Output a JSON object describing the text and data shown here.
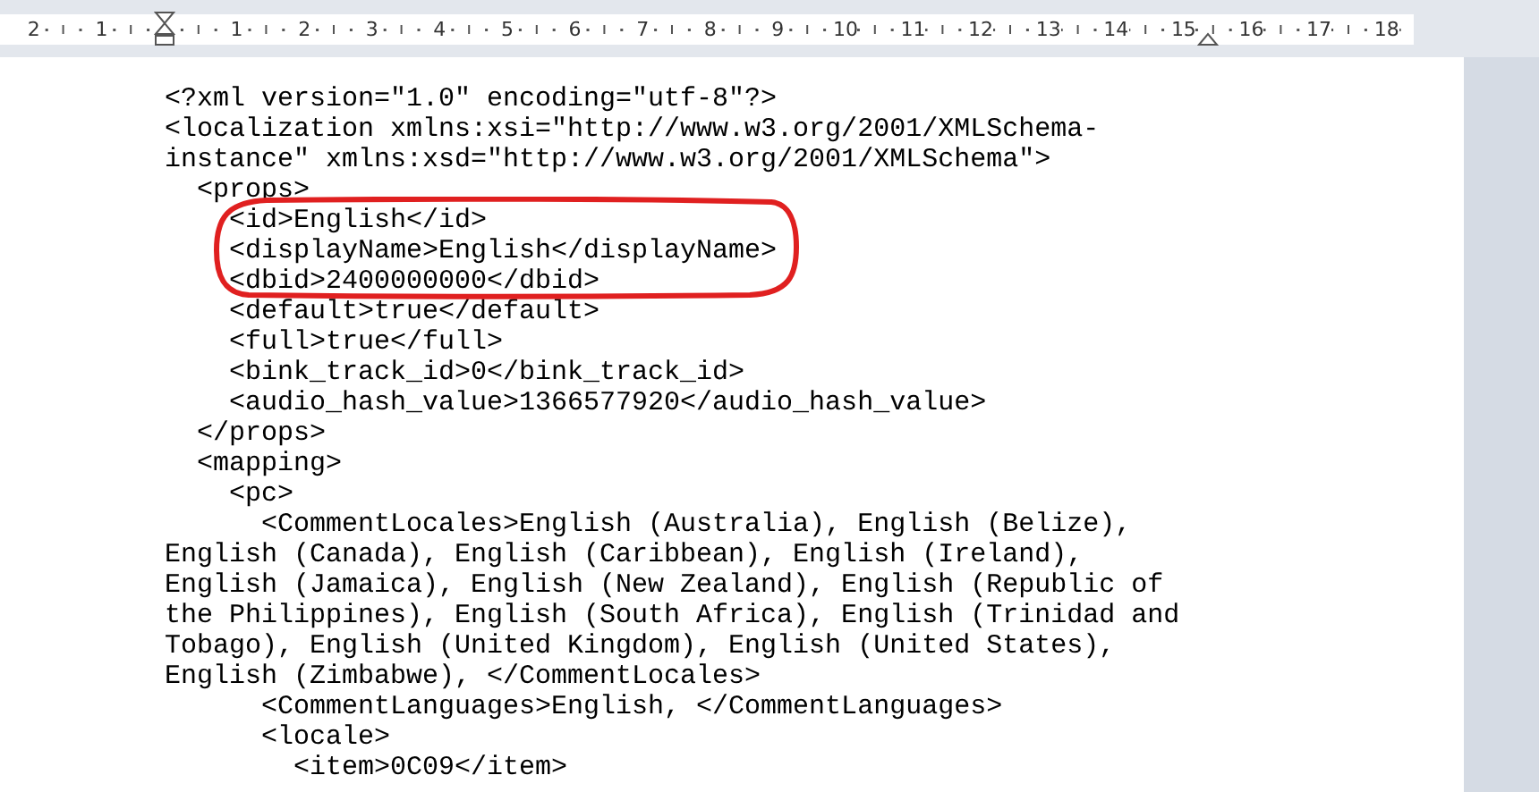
{
  "ruler": {
    "left_marks": [
      "2",
      "1"
    ],
    "marks": [
      "1",
      "2",
      "3",
      "4",
      "5",
      "6",
      "7",
      "8",
      "9",
      "10",
      "11",
      "12",
      "13",
      "14",
      "15",
      "16",
      "17",
      "18"
    ]
  },
  "document": {
    "lines": [
      "<?xml version=\"1.0\" encoding=\"utf-8\"?>",
      "<localization xmlns:xsi=\"http://www.w3.org/2001/XMLSchema-",
      "instance\" xmlns:xsd=\"http://www.w3.org/2001/XMLSchema\">",
      "  <props>",
      "    <id>English</id>",
      "    <displayName>English</displayName>",
      "    <dbid>2400000000</dbid>",
      "    <default>true</default>",
      "    <full>true</full>",
      "    <bink_track_id>0</bink_track_id>",
      "    <audio_hash_value>1366577920</audio_hash_value>",
      "  </props>",
      "  <mapping>",
      "    <pc>",
      "      <CommentLocales>English (Australia), English (Belize),",
      "English (Canada), English (Caribbean), English (Ireland),",
      "English (Jamaica), English (New Zealand), English (Republic of",
      "the Philippines), English (South Africa), English (Trinidad and",
      "Tobago), English (United Kingdom), English (United States),",
      "English (Zimbabwe), </CommentLocales>",
      "      <CommentLanguages>English, </CommentLanguages>",
      "      <locale>",
      "        <item>0C09</item>"
    ]
  }
}
